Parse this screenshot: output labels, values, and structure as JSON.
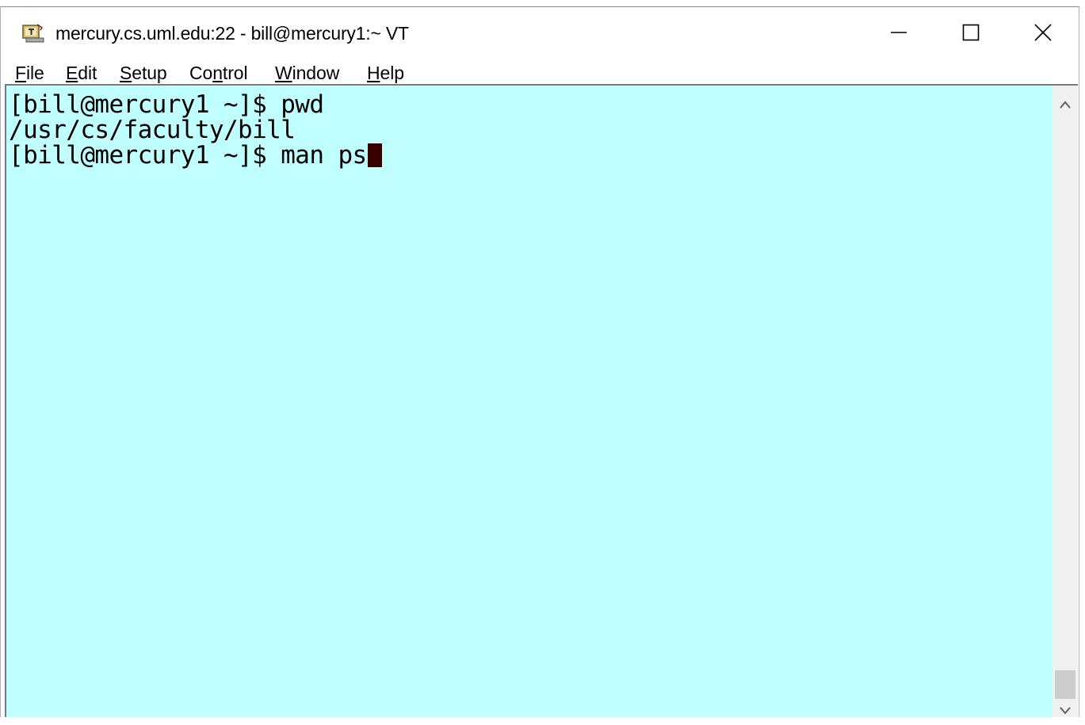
{
  "window": {
    "title": "mercury.cs.uml.edu:22 - bill@mercury1:~ VT"
  },
  "menu": [
    {
      "pre": "",
      "mn": "F",
      "post": "ile"
    },
    {
      "pre": "",
      "mn": "E",
      "post": "dit"
    },
    {
      "pre": "",
      "mn": "S",
      "post": "etup"
    },
    {
      "pre": "Co",
      "mn": "n",
      "post": "trol"
    },
    {
      "pre": "",
      "mn": "W",
      "post": "indow"
    },
    {
      "pre": "",
      "mn": "H",
      "post": "elp"
    }
  ],
  "terminal": {
    "lines": [
      "[bill@mercury1 ~]$ pwd",
      "/usr/cs/faculty/bill",
      "[bill@mercury1 ~]$ man ps"
    ],
    "background": "#c0ffff",
    "cursor_color": "#3a0000"
  },
  "icons": {
    "app": "teraterm-icon",
    "minimize": "minimize-icon",
    "maximize": "maximize-icon",
    "close": "close-icon",
    "scroll_up": "chevron-up-icon",
    "scroll_down": "chevron-down-icon"
  }
}
